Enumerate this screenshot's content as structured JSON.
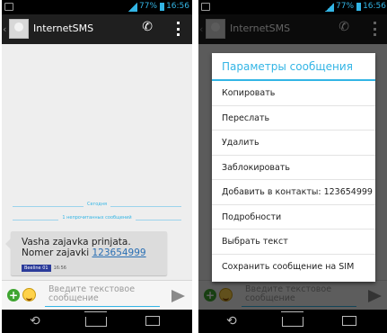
{
  "status": {
    "battery": "77%",
    "time": "16:56"
  },
  "app": {
    "title": "InternetSMS"
  },
  "conversation": {
    "date_separator": "Сегодня",
    "unread_separator": "1 непрочитанных сообщений",
    "message": {
      "text": "Vasha zajavka prinjata. Nomer zajavki ",
      "link": "123654999",
      "sim_badge": "Beeline 01",
      "time": "16:56"
    }
  },
  "input": {
    "placeholder": "Введите текстовое сообщение"
  },
  "dialog": {
    "title": "Параметры сообщения",
    "items": [
      "Копировать",
      "Переслать",
      "Удалить",
      "Заблокировать",
      "Добавить в контакты: 123654999",
      "Подробности",
      "Выбрать текст",
      "Сохранить сообщение на SIM"
    ]
  },
  "colors": {
    "accent": "#33b5e5",
    "actionbar": "#1f1f1f",
    "bubble": "#dcdcdc",
    "badge": "#2b3b9a"
  },
  "icons": [
    "notification-icon",
    "signal-icon",
    "battery-icon",
    "back-chevron-icon",
    "contact-avatar-icon",
    "call-icon",
    "overflow-menu-icon",
    "add-attachment-icon",
    "emoji-icon",
    "send-icon",
    "nav-back-icon",
    "nav-home-icon",
    "nav-recents-icon"
  ]
}
